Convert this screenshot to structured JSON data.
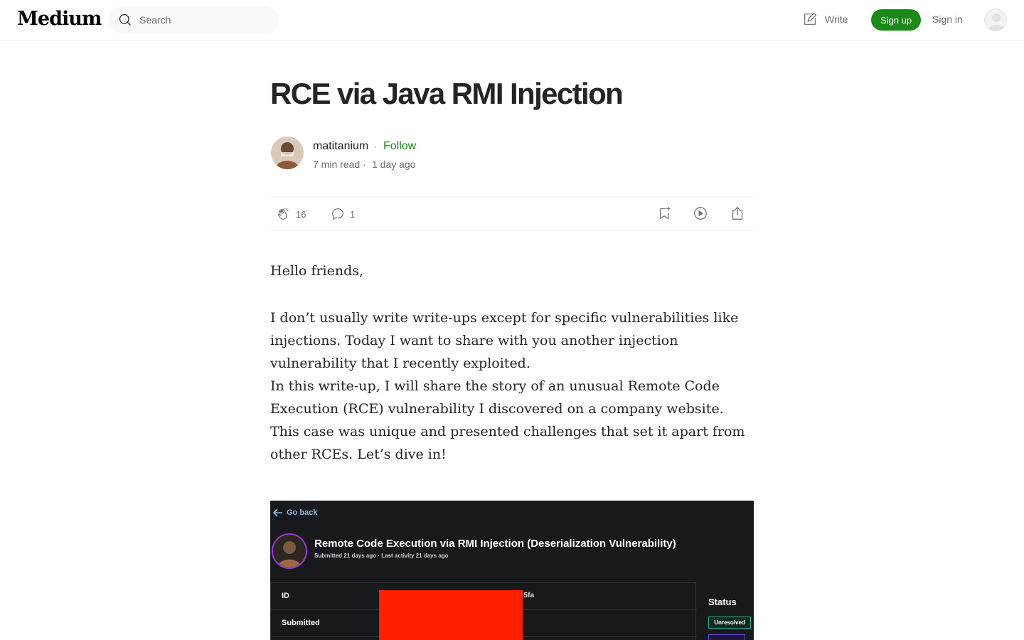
{
  "nav": {
    "logo": "Medium",
    "search_placeholder": "Search",
    "write_label": "Write",
    "signup_label": "Sign up",
    "signin_label": "Sign in"
  },
  "article": {
    "title": "RCE via Java RMI Injection",
    "author": "matitanium",
    "separator": "·",
    "follow_label": "Follow",
    "read_time": "7 min read",
    "published": "1 day ago",
    "claps": "16",
    "comments": "1",
    "paragraphs": [
      "Hello friends,",
      "I don’t usually write write-ups except for specific vulnerabilities like injections. Today I want to share with you another injection vulnerability that I recently exploited.",
      "In this write-up, I will share the story of an unusual Remote Code Execution (RCE) vulnerability I discovered on a company website. This case was unique and presented challenges that set it apart from other RCEs. Let’s dive in!"
    ]
  },
  "embedded_screenshot": {
    "go_back": "Go back",
    "report_title": "Remote Code Execution via RMI Injection (Deserialization Vulnerability)",
    "report_meta": "Submitted 21 days ago  ·   Last activity 21 days ago",
    "rows": [
      {
        "label": "ID",
        "value_tail": "25fa"
      },
      {
        "label": "Submitted"
      }
    ],
    "status_label": "Status",
    "status_badge": "Unresolved",
    "colors": {
      "redaction": "#ff2000",
      "background": "#17191c"
    }
  },
  "colors": {
    "accent": "#1a8917",
    "text": "#242424",
    "muted": "#6b6b6b"
  }
}
